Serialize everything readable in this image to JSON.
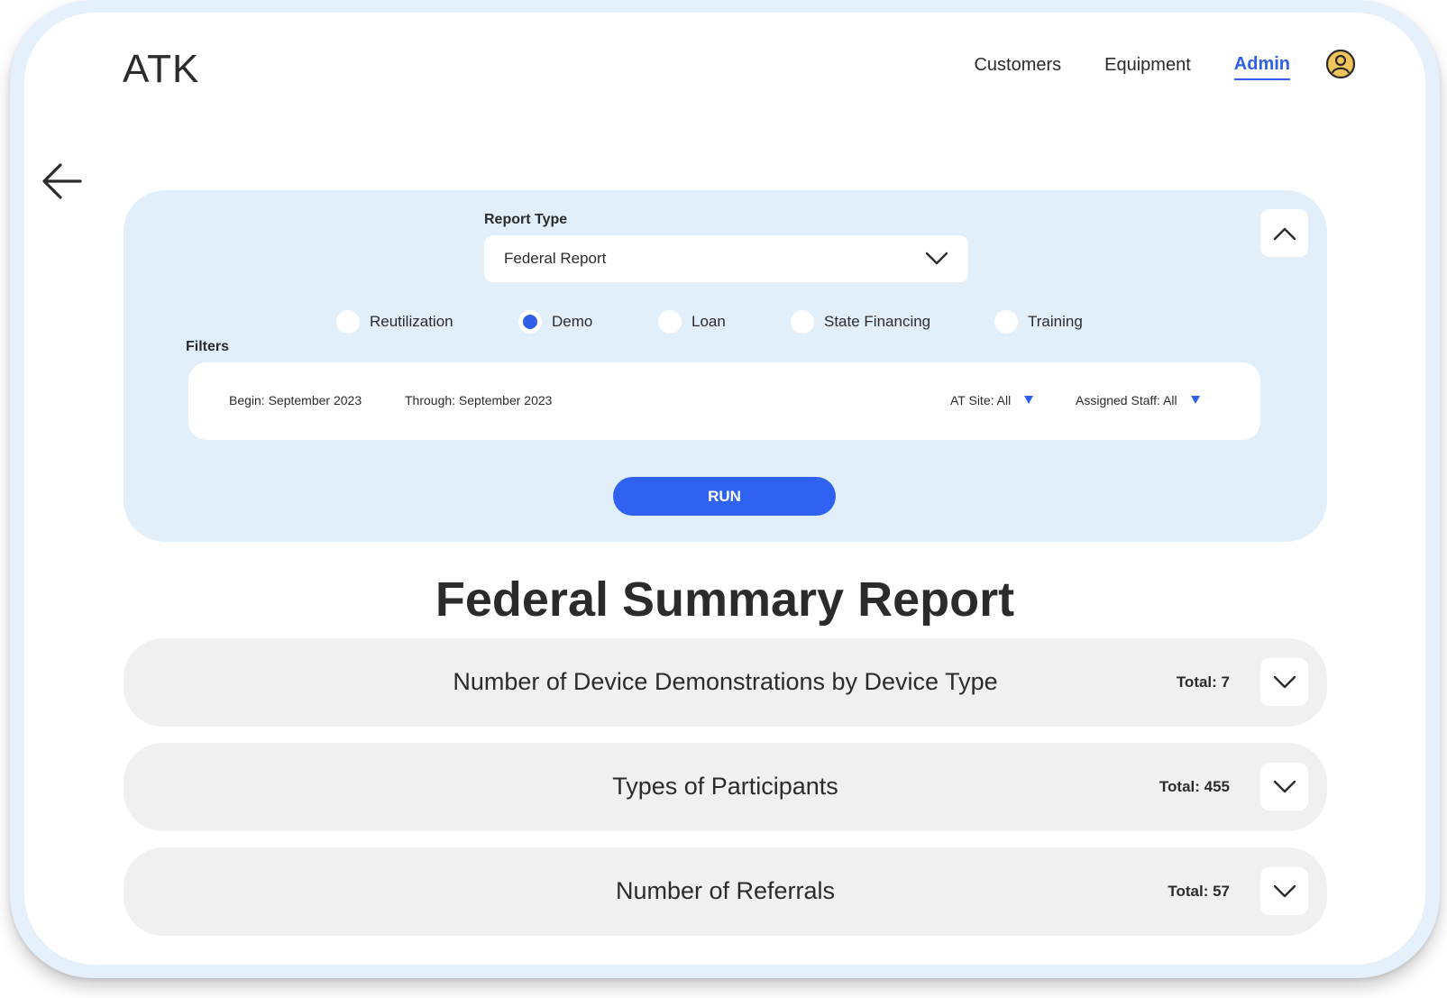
{
  "app": {
    "logo": "ATK"
  },
  "nav": {
    "customers": "Customers",
    "equipment": "Equipment",
    "admin": "Admin"
  },
  "icons": {
    "user": "user-circle-icon",
    "back": "arrow-left-icon",
    "collapse": "chevron-up-icon",
    "expand": "chevron-down-icon",
    "dropdown": "triangle-down-icon"
  },
  "colors": {
    "accent": "#2f5fe8",
    "panel_bg": "#e1effb",
    "section_bg": "#f0f0f0",
    "user_icon": "#f2c55c"
  },
  "report_panel": {
    "report_type_label": "Report Type",
    "report_type_value": "Federal Report",
    "programs": [
      {
        "label": "Reutilization",
        "checked": false
      },
      {
        "label": "Demo",
        "checked": true
      },
      {
        "label": "Loan",
        "checked": false
      },
      {
        "label": "State Financing",
        "checked": false
      },
      {
        "label": "Training",
        "checked": false
      }
    ],
    "filters_label": "Filters",
    "filters": {
      "begin": "Begin: September 2023",
      "through": "Through: September 2023",
      "at_site": "AT Site: All",
      "assigned_staff": "Assigned Staff: All"
    },
    "run_label": "RUN"
  },
  "report": {
    "title": "Federal Summary Report",
    "sections": [
      {
        "title": "Number of Device Demonstrations by Device Type",
        "total": "Total: 7"
      },
      {
        "title": "Types of Participants",
        "total": "Total: 455"
      },
      {
        "title": "Number of Referrals",
        "total": "Total: 57"
      }
    ]
  }
}
